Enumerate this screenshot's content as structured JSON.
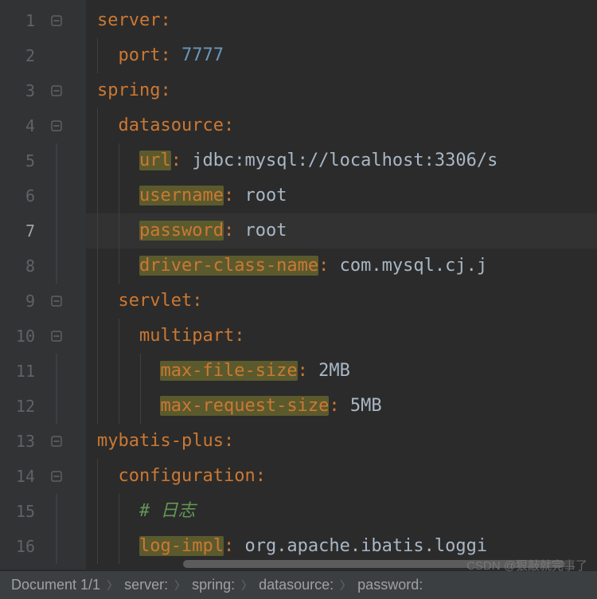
{
  "lines": [
    {
      "n": 1,
      "fold": "minus",
      "indent": 0,
      "tokens": [
        {
          "t": "server",
          "c": "key"
        },
        {
          "t": ":",
          "c": "key"
        }
      ]
    },
    {
      "n": 2,
      "fold": "none",
      "indent": 1,
      "tokens": [
        {
          "t": "  ",
          "c": ""
        },
        {
          "t": "port",
          "c": "key"
        },
        {
          "t": ": ",
          "c": "key"
        },
        {
          "t": "7777",
          "c": "val-num"
        }
      ]
    },
    {
      "n": 3,
      "fold": "minus",
      "indent": 0,
      "tokens": [
        {
          "t": "spring",
          "c": "key"
        },
        {
          "t": ":",
          "c": "key"
        }
      ]
    },
    {
      "n": 4,
      "fold": "minus",
      "indent": 1,
      "tokens": [
        {
          "t": "  ",
          "c": ""
        },
        {
          "t": "datasource",
          "c": "key"
        },
        {
          "t": ":",
          "c": "key"
        }
      ]
    },
    {
      "n": 5,
      "fold": "pipe",
      "indent": 2,
      "tokens": [
        {
          "t": "    ",
          "c": ""
        },
        {
          "t": "url",
          "c": "key",
          "hl": true
        },
        {
          "t": ": ",
          "c": "key"
        },
        {
          "t": "jdbc:mysql://localhost:3306/s",
          "c": "val-str"
        }
      ]
    },
    {
      "n": 6,
      "fold": "pipe",
      "indent": 2,
      "tokens": [
        {
          "t": "    ",
          "c": ""
        },
        {
          "t": "username",
          "c": "key",
          "hl": true
        },
        {
          "t": ": ",
          "c": "key"
        },
        {
          "t": "root",
          "c": "val-str"
        }
      ]
    },
    {
      "n": 7,
      "fold": "pipe",
      "indent": 2,
      "active": true,
      "tokens": [
        {
          "t": "    ",
          "c": ""
        },
        {
          "t": "password",
          "c": "key",
          "hl": true
        },
        {
          "t": ": ",
          "c": "key"
        },
        {
          "t": "root",
          "c": "val-str"
        }
      ]
    },
    {
      "n": 8,
      "fold": "pipe",
      "indent": 2,
      "tokens": [
        {
          "t": "    ",
          "c": ""
        },
        {
          "t": "driver-class-name",
          "c": "key",
          "hl": true
        },
        {
          "t": ": ",
          "c": "key"
        },
        {
          "t": "com.mysql.cj.j",
          "c": "val-str"
        }
      ]
    },
    {
      "n": 9,
      "fold": "minus",
      "indent": 1,
      "tokens": [
        {
          "t": "  ",
          "c": ""
        },
        {
          "t": "servlet",
          "c": "key"
        },
        {
          "t": ":",
          "c": "key"
        }
      ]
    },
    {
      "n": 10,
      "fold": "minus",
      "indent": 2,
      "tokens": [
        {
          "t": "    ",
          "c": ""
        },
        {
          "t": "multipart",
          "c": "key"
        },
        {
          "t": ":",
          "c": "key"
        }
      ]
    },
    {
      "n": 11,
      "fold": "pipe",
      "indent": 3,
      "tokens": [
        {
          "t": "      ",
          "c": ""
        },
        {
          "t": "max-file-size",
          "c": "key",
          "hl": true
        },
        {
          "t": ": ",
          "c": "key"
        },
        {
          "t": "2MB",
          "c": "val-str"
        }
      ]
    },
    {
      "n": 12,
      "fold": "pipe",
      "indent": 3,
      "tokens": [
        {
          "t": "      ",
          "c": ""
        },
        {
          "t": "max-request-size",
          "c": "key",
          "hl": true
        },
        {
          "t": ": ",
          "c": "key"
        },
        {
          "t": "5MB",
          "c": "val-str"
        }
      ]
    },
    {
      "n": 13,
      "fold": "minus",
      "indent": 0,
      "tokens": [
        {
          "t": "mybatis-plus",
          "c": "key"
        },
        {
          "t": ":",
          "c": "key"
        }
      ]
    },
    {
      "n": 14,
      "fold": "minus",
      "indent": 1,
      "tokens": [
        {
          "t": "  ",
          "c": ""
        },
        {
          "t": "configuration",
          "c": "key"
        },
        {
          "t": ":",
          "c": "key"
        }
      ]
    },
    {
      "n": 15,
      "fold": "pipe",
      "indent": 2,
      "tokens": [
        {
          "t": "    ",
          "c": ""
        },
        {
          "t": "# 日志",
          "c": "comment-green"
        }
      ]
    },
    {
      "n": 16,
      "fold": "pipe",
      "indent": 2,
      "tokens": [
        {
          "t": "    ",
          "c": ""
        },
        {
          "t": "log-impl",
          "c": "key",
          "hl": true
        },
        {
          "t": ": ",
          "c": "key"
        },
        {
          "t": "org.apache.ibatis.loggi",
          "c": "val-str"
        }
      ]
    }
  ],
  "breadcrumbs": {
    "doc": "Document 1/1",
    "items": [
      "server:",
      "spring:",
      "datasource:",
      "password:"
    ]
  },
  "watermark": "CSDN @狠敲就完事了"
}
